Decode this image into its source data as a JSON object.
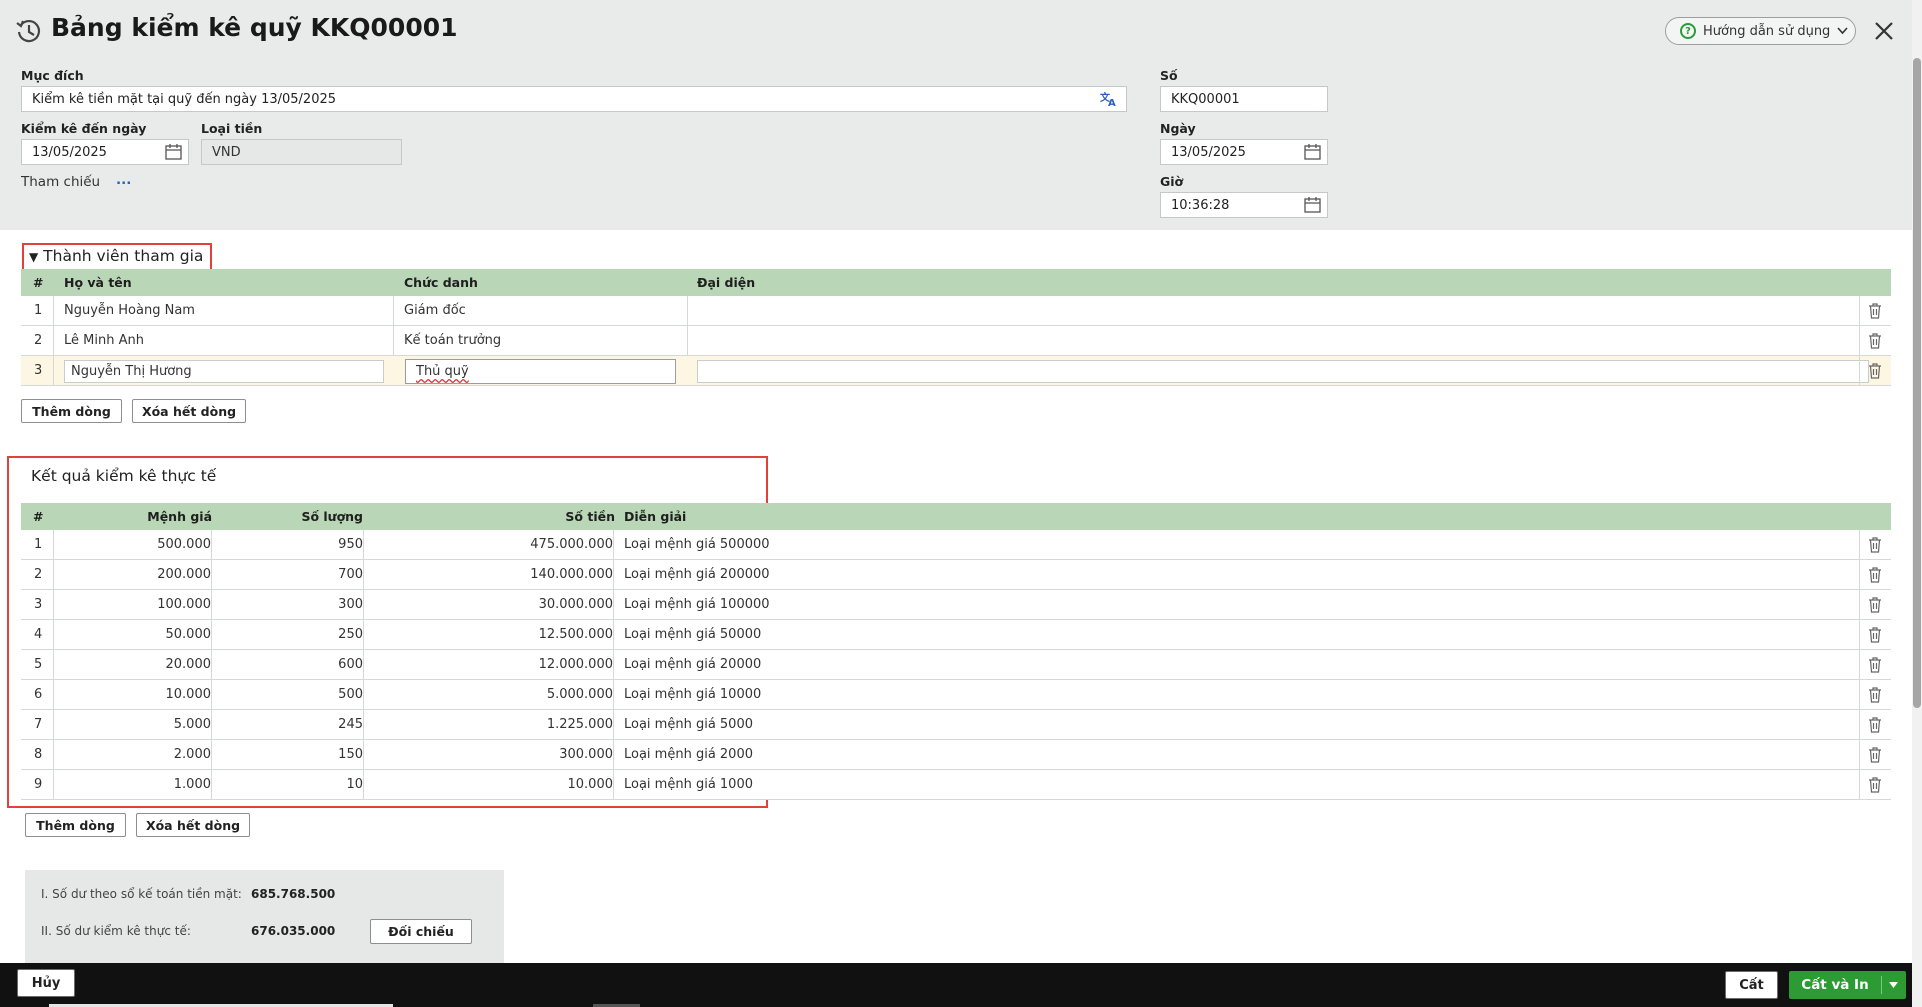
{
  "header": {
    "title": "Bảng kiểm kê quỹ KKQ00001",
    "help_label": "Hướng dẫn sử dụng"
  },
  "form": {
    "purpose_label": "Mục đích",
    "purpose_value": "Kiểm kê tiền mặt tại quỹ đến ngày 13/05/2025",
    "check_date_label": "Kiểm kê đến ngày",
    "check_date_value": "13/05/2025",
    "currency_label": "Loại tiền",
    "currency_value": "VND",
    "reference_label": "Tham chiếu",
    "reference_link": "...",
    "number_label": "Số",
    "number_value": "KKQ00001",
    "date_label": "Ngày",
    "date_value": "13/05/2025",
    "time_label": "Giờ",
    "time_value": "10:36:28"
  },
  "members": {
    "section_title": "Thành viên tham gia",
    "columns": [
      "#",
      "Họ và tên",
      "Chức danh",
      "Đại diện"
    ],
    "rows": [
      {
        "no": "1",
        "name": "Nguyễn Hoàng Nam",
        "position": "Giám đốc",
        "representative": ""
      },
      {
        "no": "2",
        "name": "Lê Minh Anh",
        "position": "Kế toán trưởng",
        "representative": ""
      },
      {
        "no": "3",
        "name": "Nguyễn Thị Hương",
        "position": "Thủ quỹ",
        "representative": ""
      }
    ],
    "add_row_label": "Thêm dòng",
    "delete_all_label": "Xóa hết dòng"
  },
  "results": {
    "section_title": "Kết quả kiểm kê thực tế",
    "columns": [
      "#",
      "Mệnh giá",
      "Số lượng",
      "Số tiền",
      "Diễn giải"
    ],
    "rows": [
      {
        "no": "1",
        "denomination": "500.000",
        "quantity": "950",
        "amount": "475.000.000",
        "desc": "Loại mệnh giá 500000"
      },
      {
        "no": "2",
        "denomination": "200.000",
        "quantity": "700",
        "amount": "140.000.000",
        "desc": "Loại mệnh giá 200000"
      },
      {
        "no": "3",
        "denomination": "100.000",
        "quantity": "300",
        "amount": "30.000.000",
        "desc": "Loại mệnh giá 100000"
      },
      {
        "no": "4",
        "denomination": "50.000",
        "quantity": "250",
        "amount": "12.500.000",
        "desc": "Loại mệnh giá 50000"
      },
      {
        "no": "5",
        "denomination": "20.000",
        "quantity": "600",
        "amount": "12.000.000",
        "desc": "Loại mệnh giá 20000"
      },
      {
        "no": "6",
        "denomination": "10.000",
        "quantity": "500",
        "amount": "5.000.000",
        "desc": "Loại mệnh giá 10000"
      },
      {
        "no": "7",
        "denomination": "5.000",
        "quantity": "245",
        "amount": "1.225.000",
        "desc": "Loại mệnh giá 5000"
      },
      {
        "no": "8",
        "denomination": "2.000",
        "quantity": "150",
        "amount": "300.000",
        "desc": "Loại mệnh giá 2000"
      },
      {
        "no": "9",
        "denomination": "1.000",
        "quantity": "10",
        "amount": "10.000",
        "desc": "Loại mệnh giá 1000"
      }
    ],
    "add_row_label": "Thêm dòng",
    "delete_all_label": "Xóa hết dòng"
  },
  "summary": {
    "book_balance_label": "I. Số dư theo sổ kế toán tiền mặt:",
    "book_balance_value": "685.768.500",
    "actual_balance_label": "II. Số dư kiểm kê thực tế:",
    "actual_balance_value": "676.035.000",
    "reconcile_label": "Đối chiếu"
  },
  "footer": {
    "cancel_label": "Hủy",
    "save_label": "Cất",
    "save_print_label": "Cất và In"
  },
  "colors": {
    "header_bg": "#e9ebeb",
    "table_header": "#b9d6b6",
    "highlight_box": "#e0413b",
    "primary_green": "#2d9b34",
    "footer_bg": "#111111"
  }
}
